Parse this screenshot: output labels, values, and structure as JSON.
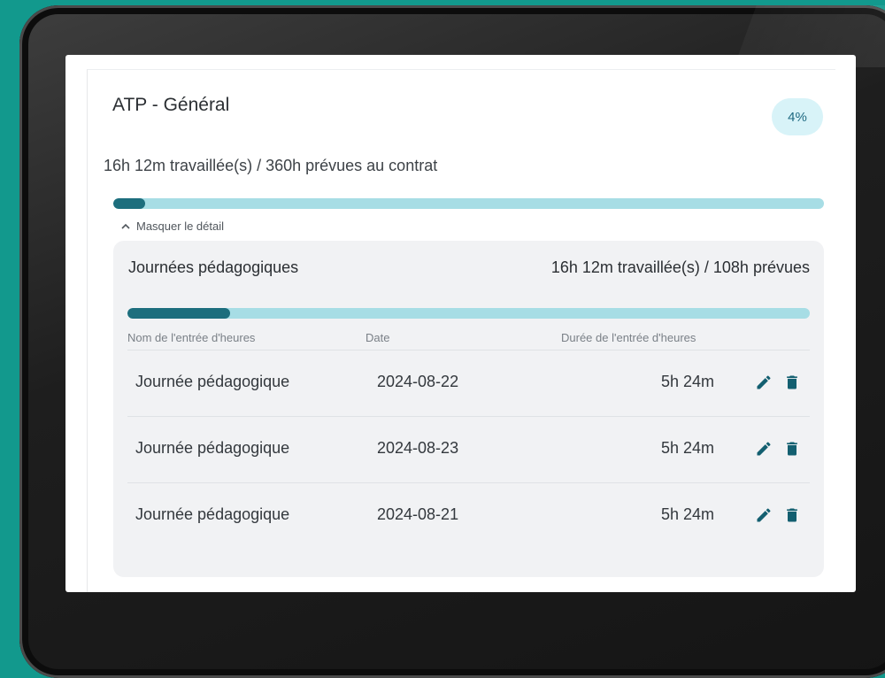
{
  "card": {
    "title": "ATP - Général",
    "percent_badge": "4%",
    "summary": "16h 12m travaillée(s) / 360h prévues au contrat",
    "progress_fraction": 0.045,
    "toggle_label": "Masquer le détail"
  },
  "section": {
    "title": "Journées pédagogiques",
    "summary": "16h 12m travaillée(s) / 108h prévues",
    "progress_fraction": 0.15,
    "columns": {
      "name": "Nom de l'entrée d'heures",
      "date": "Date",
      "duration": "Durée de l'entrée d'heures"
    },
    "rows": [
      {
        "name": "Journée pédagogique",
        "date": "2024-08-22",
        "duration": "5h 24m"
      },
      {
        "name": "Journée pédagogique",
        "date": "2024-08-23",
        "duration": "5h 24m"
      },
      {
        "name": "Journée pédagogique",
        "date": "2024-08-21",
        "duration": "5h 24m"
      }
    ]
  },
  "colors": {
    "background": "#12998d",
    "progress_fill": "#1d6e7d",
    "progress_track": "#a7dde5",
    "badge_bg": "#d8f3f8"
  },
  "icons": {
    "toggle": "chevron-up-icon",
    "edit": "pencil-icon",
    "delete": "trash-icon"
  }
}
